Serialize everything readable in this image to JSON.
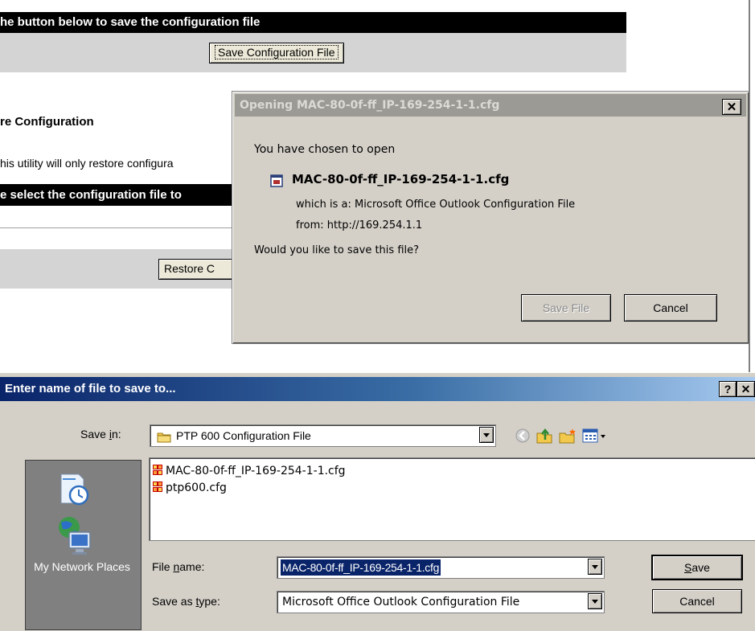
{
  "background_page": {
    "save_header": "he button below to save the configuration file",
    "save_button": "Save Configuration File",
    "restore_heading": "re Configuration",
    "restore_note": "his utility will only restore configura",
    "select_header": "e select the configuration file to",
    "restore_button": "Restore C"
  },
  "opening_dialog": {
    "title": "Opening MAC-80-0f-ff_IP-169-254-1-1.cfg",
    "close_glyph": "✕",
    "intro": "You have chosen to open",
    "filename": "MAC-80-0f-ff_IP-169-254-1-1.cfg",
    "type_label": "which is a:",
    "type_value": "Microsoft Office Outlook Configuration File",
    "from_label": "from:",
    "from_value": "http://169.254.1.1",
    "question": "Would you like to save this file?",
    "save_button": "Save File",
    "cancel_button": "Cancel"
  },
  "save_dialog": {
    "title": "Enter name of file to save to...",
    "help_glyph": "?",
    "close_glyph": "✕",
    "save_in_label_prefix": "Save ",
    "save_in_label_accel": "i",
    "save_in_label_suffix": "n:",
    "save_in_value": "PTP 600 Configuration File",
    "files": [
      "MAC-80-0f-ff_IP-169-254-1-1.cfg",
      "ptp600.cfg"
    ],
    "places_label": "My Network Places",
    "filename_label_prefix": "File ",
    "filename_label_accel": "n",
    "filename_label_suffix": "ame:",
    "filename_value": "MAC-80-0f-ff_IP-169-254-1-1.cfg",
    "savetype_label_prefix": "Save as ",
    "savetype_label_accel": "t",
    "savetype_label_suffix": "ype:",
    "savetype_value": "Microsoft Office Outlook Configuration File",
    "save_button_accel": "S",
    "save_button_rest": "ave",
    "cancel_button": "Cancel"
  }
}
